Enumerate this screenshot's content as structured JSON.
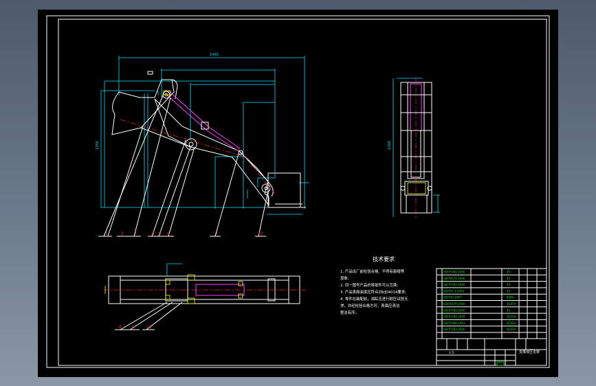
{
  "notes": {
    "title": "技术要求",
    "lines": [
      "1. 产品出厂前检验合格、不得有裂缝等",
      "现象;",
      "2. 同一图号产品的零部件可以互换;",
      "3. 产品表面油漆应符合ZB/J04014要求;",
      "4. 零件在装配前，油缸应进行耐压试验无",
      "渗，并经检验合格方可，表面应清洁",
      "整洁有序。"
    ]
  },
  "title_block": {
    "drawing_name": "支撑液压支架",
    "scale_cell": "1:5"
  },
  "parts_table": {
    "rows": [
      {
        "code": "GB/T5781-2000",
        "mat": "45"
      },
      {
        "code": "GB/T6170-2000",
        "mat": "45"
      },
      {
        "code": "GB/T5783-2000",
        "mat": "45"
      },
      {
        "code": "GB/T97.1-2002",
        "mat": "45"
      },
      {
        "code": "GB/T93-1987",
        "mat": "65Mn"
      },
      {
        "code": "GB/T6170-2000",
        "mat": "Q235A"
      },
      {
        "code": "GB/T5782-2000",
        "mat": "45"
      },
      {
        "code": "GB/T5781-2000",
        "mat": "Q235A"
      },
      {
        "code": "GB/T1096-2003",
        "mat": "Q235A"
      },
      {
        "code": "GB/T5783-2000",
        "mat": "Q235A"
      }
    ]
  },
  "balloons": {
    "main": [
      "1",
      "2",
      "3",
      "4",
      "5",
      "6",
      "7",
      "10"
    ],
    "bottom": [
      "8",
      "9",
      "11"
    ]
  },
  "colors": {
    "background": "#000000",
    "outline": "#ffffff",
    "dimension": "#00e5ff",
    "centerline": "#ff2a2a",
    "table_text": "#00e000",
    "cylinder": "#ff40ff"
  }
}
